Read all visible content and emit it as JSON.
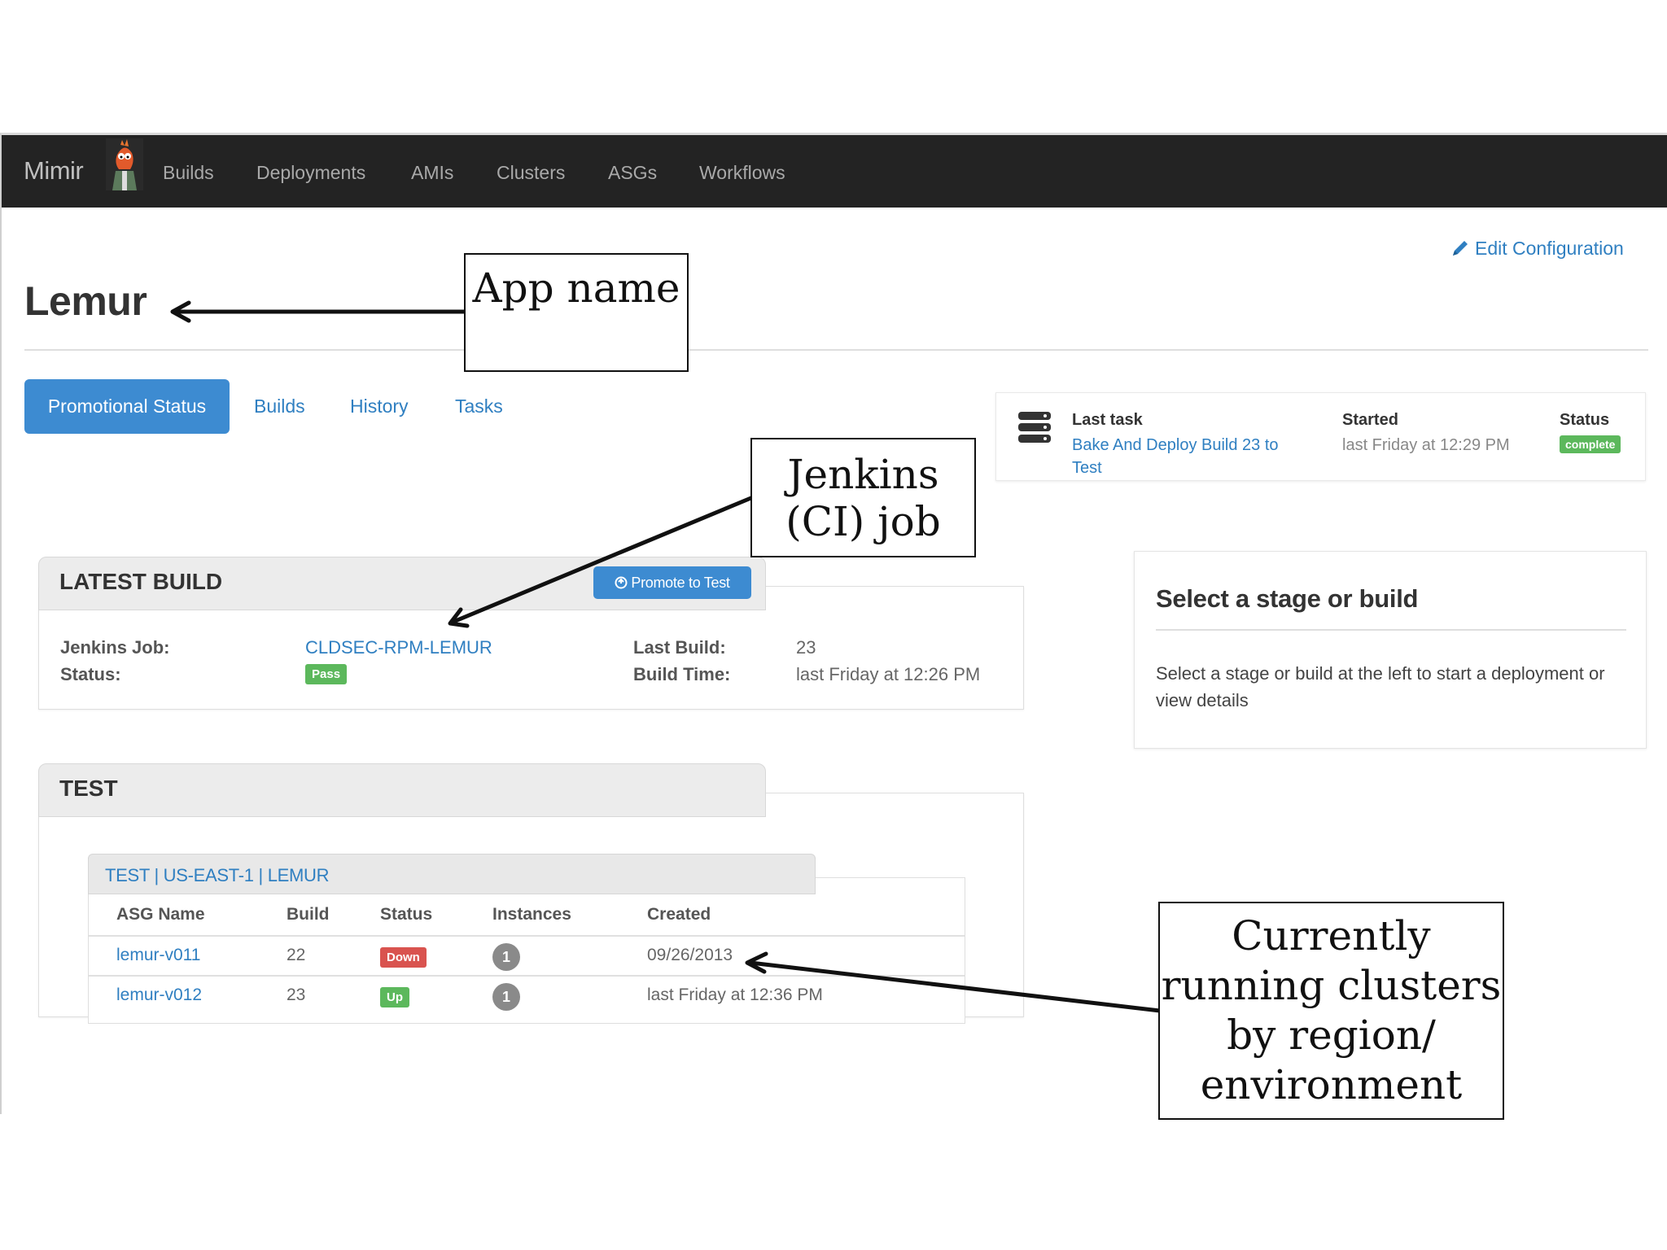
{
  "navbar": {
    "brand": "Mimir",
    "items": [
      "Builds",
      "Deployments",
      "AMIs",
      "Clusters",
      "ASGs",
      "Workflows"
    ]
  },
  "page": {
    "title": "Lemur",
    "edit_config": "Edit Configuration"
  },
  "tabs": [
    {
      "label": "Promotional Status",
      "active": true
    },
    {
      "label": "Builds",
      "active": false
    },
    {
      "label": "History",
      "active": false
    },
    {
      "label": "Tasks",
      "active": false
    }
  ],
  "last_task": {
    "last_task_label": "Last task",
    "last_task_value": "Bake And Deploy Build 23 to Test",
    "started_label": "Started",
    "started_value": "last Friday at 12:29 PM",
    "status_label": "Status",
    "status_value": "complete"
  },
  "latest_build": {
    "title": "LATEST BUILD",
    "promote_button": "Promote to Test",
    "jenkins_job_label": "Jenkins Job:",
    "jenkins_job_value": "CLDSEC-RPM-LEMUR",
    "status_label": "Status:",
    "status_value": "Pass",
    "last_build_label": "Last Build:",
    "last_build_value": "23",
    "build_time_label": "Build Time:",
    "build_time_value": "last Friday at 12:26 PM"
  },
  "test": {
    "title": "TEST",
    "asg_group_title": "TEST | US-EAST-1 | LEMUR",
    "columns": [
      "ASG Name",
      "Build",
      "Status",
      "Instances",
      "Created"
    ],
    "rows": [
      {
        "asg_name": "lemur-v011",
        "build": "22",
        "status": "Down",
        "instances": "1",
        "created": "09/26/2013"
      },
      {
        "asg_name": "lemur-v012",
        "build": "23",
        "status": "Up",
        "instances": "1",
        "created": "last Friday at 12:36 PM"
      }
    ]
  },
  "select_panel": {
    "title": "Select a stage or build",
    "text": "Select a stage or build at the left to start a deployment or view details"
  },
  "annotations": {
    "app_name": "App name",
    "jenkins_job": "Jenkins (CI) job",
    "clusters": "Currently running clusters by region/ environment"
  },
  "colors": {
    "navbar_bg": "#232323",
    "accent": "#3d8bd1",
    "link": "#2f7fc1",
    "success": "#5cb85c",
    "danger": "#d9534f"
  },
  "icons": {
    "mascot": "beaker-mascot-icon",
    "edit": "pencil-icon",
    "server": "server-icon",
    "promote": "circle-arrow-icon"
  }
}
